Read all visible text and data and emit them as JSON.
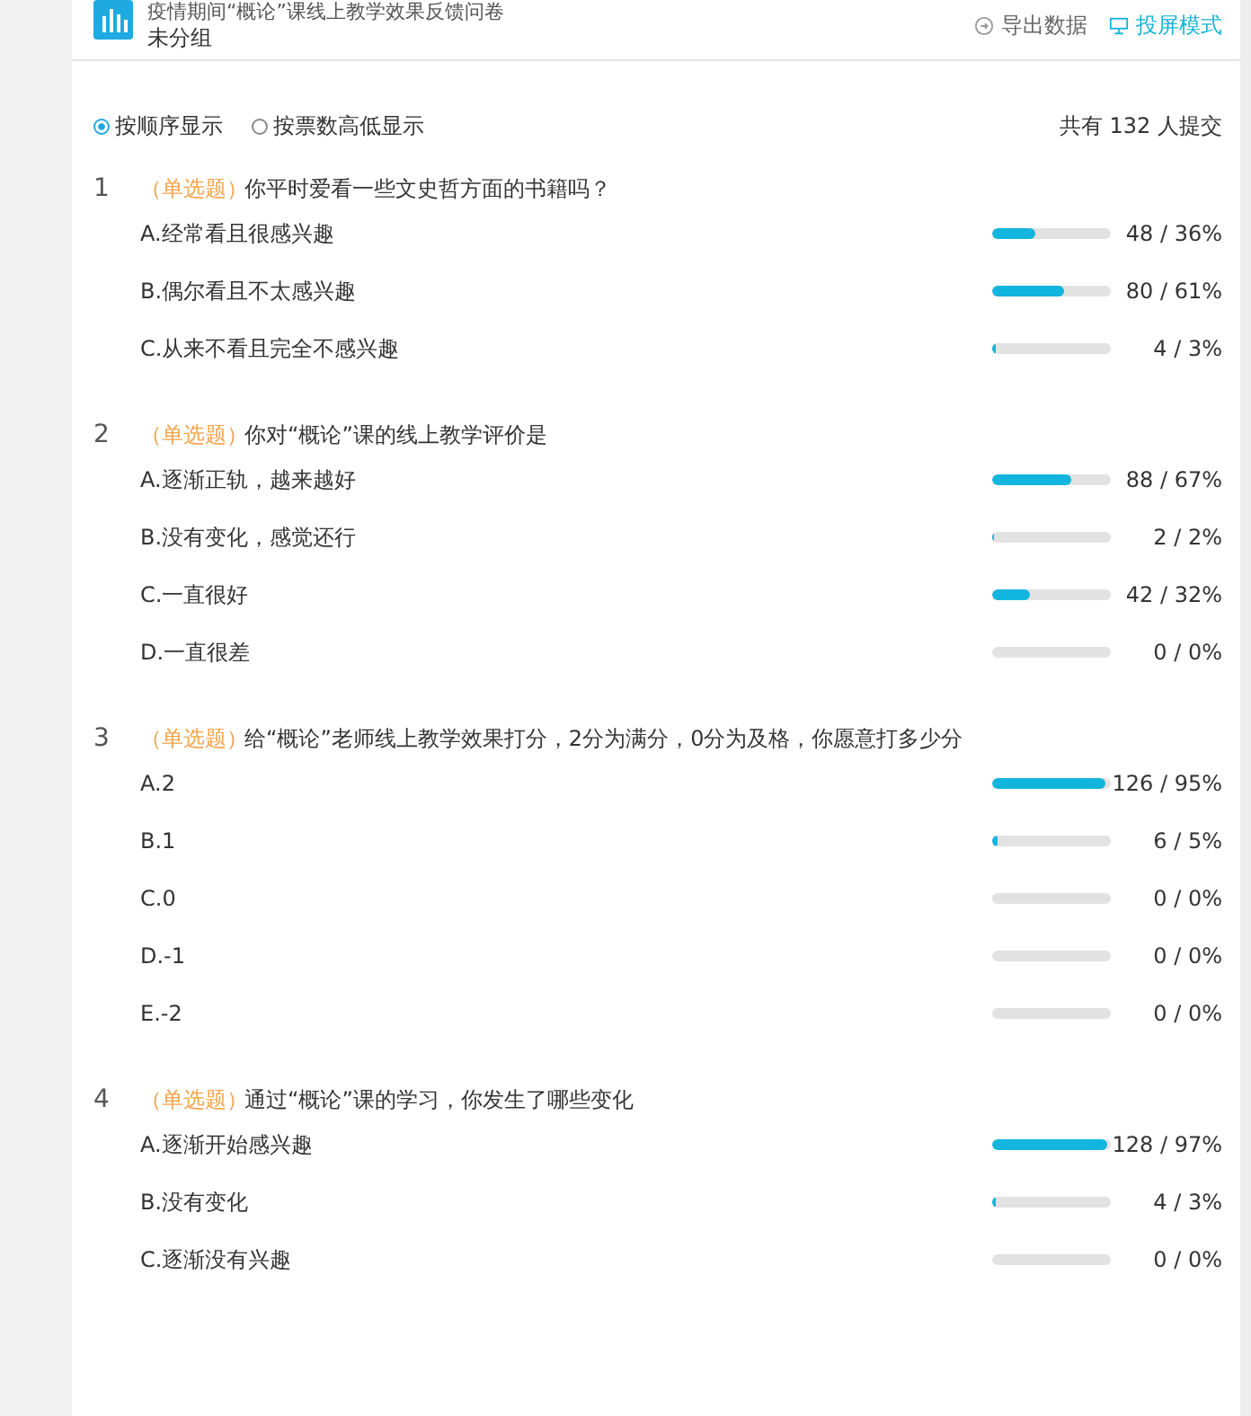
{
  "header": {
    "title": "疫情期间“概论”课线上教学效果反馈问卷",
    "group": "未分组",
    "actions": [
      {
        "kind": "export",
        "label": "导出数据"
      },
      {
        "kind": "projector",
        "label": "投屏模式"
      }
    ]
  },
  "sort_options": [
    {
      "label": "按顺序显示",
      "selected": true
    },
    {
      "label": "按票数高低显示",
      "selected": false
    }
  ],
  "summary": "共有 132 人提交",
  "questions": [
    {
      "number": "1",
      "type": "（单选题）",
      "text": "你平时爱看一些文史哲方面的书籍吗？",
      "options": [
        {
          "label": "A.经常看且很感兴趣",
          "level": 0.36,
          "result": "48 / 36%"
        },
        {
          "label": "B.偶尔看且不太感兴趣",
          "level": 0.61,
          "result": "80 / 61%"
        },
        {
          "label": "C.从来不看且完全不感兴趣",
          "level": 0.03,
          "result": "4 / 3%"
        }
      ]
    },
    {
      "number": "2",
      "type": "（单选题）",
      "text": "你对“概论”课的线上教学评价是",
      "options": [
        {
          "label": "A.逐渐正轨，越来越好",
          "level": 0.67,
          "result": "88 / 67%"
        },
        {
          "label": "B.没有变化，感觉还行",
          "level": 0.02,
          "result": "2 / 2%"
        },
        {
          "label": "C.一直很好",
          "level": 0.32,
          "result": "42 / 32%"
        },
        {
          "label": "D.一直很差",
          "result": "0 / 0%"
        }
      ]
    },
    {
      "number": "3",
      "type": "（单选题）",
      "text": "给“概论”老师线上教学效果打分，2分为满分，0分为及格，你愿意打多少分",
      "options": [
        {
          "label": "A.2",
          "level": 0.95,
          "result": "126 / 95%"
        },
        {
          "label": "B.1",
          "level": 0.05,
          "result": "6 / 5%"
        },
        {
          "label": "C.0",
          "result": "0 / 0%"
        },
        {
          "label": "D.-1",
          "result": "0 / 0%"
        },
        {
          "label": "E.-2",
          "result": "0 / 0%"
        }
      ]
    },
    {
      "number": "4",
      "type": "（单选题）",
      "text": "通过“概论”课的学习，你发生了哪些变化",
      "options": [
        {
          "label": "A.逐渐开始感兴趣",
          "level": 0.97,
          "result": "128 / 97%"
        },
        {
          "label": "B.没有变化",
          "level": 0.03,
          "result": "4 / 3%"
        },
        {
          "label": "C.逐渐没有兴趣",
          "result": "0 / 0%"
        }
      ]
    }
  ]
}
